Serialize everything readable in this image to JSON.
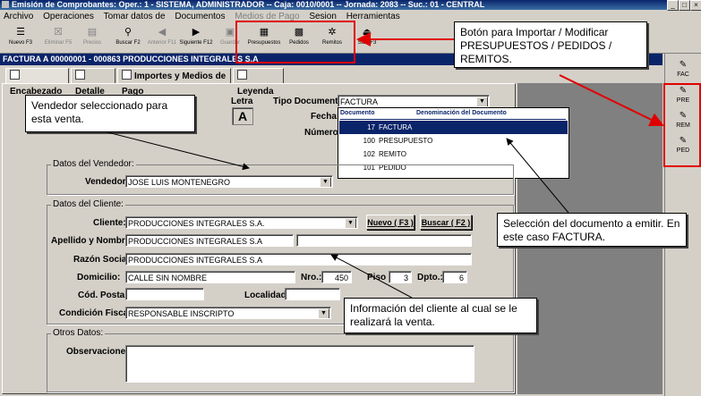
{
  "window": {
    "title": "Emisión de Comprobantes: Oper.: 1 - SISTEMA, ADMINISTRADOR  -- Caja: 0010/0001  --  Jornada: 2083  --  Suc.: 01 - CENTRAL",
    "min": "_",
    "max": "□",
    "close": "×"
  },
  "menu": [
    "Archivo",
    "Operaciones",
    "Tomar datos de",
    "Documentos",
    "Medios de Pago",
    "Sesion",
    "Herramientas"
  ],
  "toolbar": [
    {
      "label": "Nuevo F3",
      "icon": "new-icon",
      "glyph": "☰"
    },
    {
      "label": "Eliminar F5",
      "icon": "delete-icon",
      "glyph": "☒"
    },
    {
      "label": "Precios",
      "icon": "prices-icon",
      "glyph": "▤"
    },
    {
      "label": "Buscar F2",
      "icon": "binoculars-icon",
      "glyph": "⚲"
    },
    {
      "label": "Anterior F11",
      "icon": "previous-icon",
      "glyph": "◀"
    },
    {
      "label": "Siguiente F12",
      "icon": "next-icon",
      "glyph": "▶"
    },
    {
      "label": "Guardar",
      "icon": "save-icon",
      "glyph": "▣"
    },
    {
      "label": "Presupuestos",
      "icon": "quotes-icon",
      "glyph": "▦"
    },
    {
      "label": "Pedidos",
      "icon": "orders-icon",
      "glyph": "▩"
    },
    {
      "label": "Remitos",
      "icon": "delivery-notes-icon",
      "glyph": "✲"
    },
    {
      "label": "Salir F3",
      "icon": "exit-icon",
      "glyph": "⏏"
    }
  ],
  "form_title": "FACTURA A  00000001 - 000863  PRODUCCIONES INTEGRALES S.A",
  "tabs": [
    "Encabezado",
    "Detalle",
    "Importes y Medios de Pago",
    "Leyenda"
  ],
  "right_buttons": [
    "FAC",
    "PRE",
    "REM",
    "PED"
  ],
  "header": {
    "letra_label": "Letra",
    "letra": "A",
    "tipo_label": "Tipo Documento:",
    "tipo_value": "FACTURA",
    "fecha_label": "Fecha:",
    "numero_label": "Número:"
  },
  "dropdown": {
    "col1": "Documento",
    "col2": "Denominación del Documento",
    "rows": [
      {
        "code": "17",
        "name": "FACTURA",
        "selected": true
      },
      {
        "code": "100",
        "name": "PRESUPUESTO",
        "selected": false
      },
      {
        "code": "102",
        "name": "REMITO",
        "selected": false
      },
      {
        "code": "101",
        "name": "PEDIDO",
        "selected": false
      }
    ]
  },
  "vendedor": {
    "group": "Datos del Vendedor:",
    "label": "Vendedor:",
    "value": "JOSE LUIS MONTENEGRO"
  },
  "cliente": {
    "group": "Datos del Cliente:",
    "cliente_label": "Cliente:",
    "cliente_value": "PRODUCCIONES INTEGRALES S.A.",
    "nuevo": "Nuevo ( F3 )",
    "buscar": "Buscar ( F2 )",
    "apellido_label": "Apellido y Nombres:",
    "apellido_value": "PRODUCCIONES INTEGRALES S.A",
    "razon_label": "Razón Social:",
    "razon_value": "PRODUCCIONES INTEGRALES S.A",
    "domicilio_label": "Domicilio:",
    "domicilio_value": "CALLE SIN NOMBRE",
    "nro_label": "Nro.:",
    "nro_value": "450",
    "piso_label": "Piso",
    "piso_value": "3",
    "dpto_label": "Dpto.:",
    "dpto_value": "6",
    "cp_label": "Cód. Postal:",
    "localidad_label": "Localidad:",
    "condicion_label": "Condición Fiscal:",
    "condicion_value": "RESPONSABLE INSCRIPTO"
  },
  "otros": {
    "group": "Otros Datos:",
    "obs_label": "Observaciones:"
  },
  "callouts": {
    "vendedor": "Vendedor seleccionado para esta venta.",
    "importar": "Botón para Importar / Modificar PRESUPUESTOS / PEDIDOS / REMITOS.",
    "seleccion": "Selección del documento a emitir. En este caso FACTURA.",
    "cliente": "Información del cliente al cual se le realizará la venta."
  },
  "colors": {
    "accent_red": "#e00000",
    "title_blue": "#0a246a",
    "face": "#d4d0c8"
  }
}
